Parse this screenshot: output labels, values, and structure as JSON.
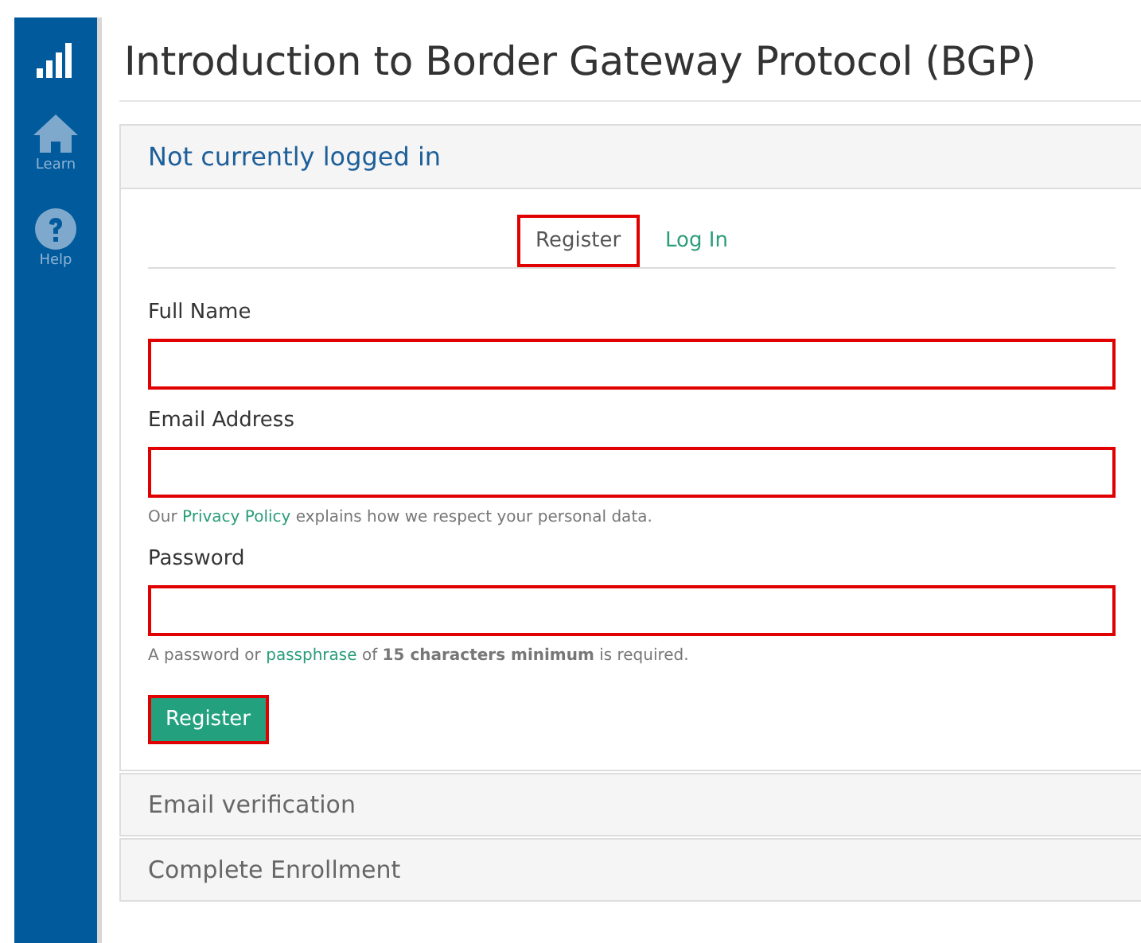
{
  "sidebar": {
    "items": [
      {
        "kind": "logo"
      },
      {
        "kind": "home",
        "label": "Learn"
      },
      {
        "kind": "help",
        "label": "Help"
      }
    ]
  },
  "title": "Introduction to Border Gateway Protocol (BGP)",
  "panel": {
    "heading": "Not currently logged in",
    "tabs": [
      {
        "label": "Register",
        "selected": true,
        "highlighted": true
      },
      {
        "label": "Log In",
        "selected": false,
        "highlighted": false
      }
    ],
    "fields": [
      {
        "label": "Full Name",
        "highlighted": true
      },
      {
        "label": "Email Address",
        "highlighted": true,
        "help": [
          {
            "kind": "text",
            "text": "Our"
          },
          {
            "kind": "link",
            "text": "Privacy Policy"
          },
          {
            "kind": "text",
            "text": "explains how we respect your personal data."
          }
        ]
      },
      {
        "label": "Password",
        "highlighted": true,
        "help": [
          {
            "kind": "text",
            "text": "A password or"
          },
          {
            "kind": "link",
            "text": "passphrase"
          },
          {
            "kind": "text",
            "text": "of **15 characters minimum** is required."
          }
        ]
      }
    ],
    "button": {
      "label": "Register",
      "highlighted": true
    }
  },
  "sections": [
    "Email verification",
    "Complete Enrollment"
  ]
}
